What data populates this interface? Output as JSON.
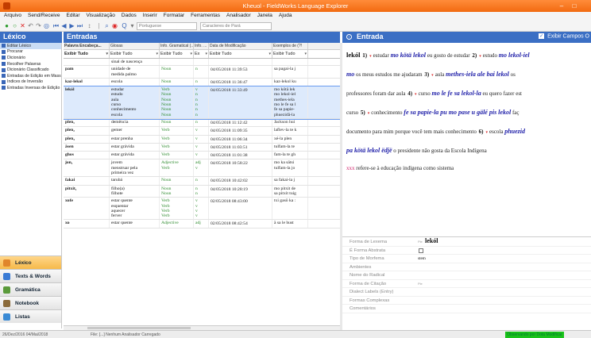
{
  "window": {
    "title": "Kheuol - FieldWorks Language Explorer",
    "minimize_glyph": "‒",
    "maximize_glyph": "□"
  },
  "menu": [
    "Arquivo",
    "Send/Receive",
    "Editar",
    "Visualização",
    "Dados",
    "Inserir",
    "Formatar",
    "Ferramentas",
    "Analisador",
    "Janela",
    "Ajuda"
  ],
  "toolbar": {
    "writing_system": "Portuguese",
    "style": "Caracteres de Pará"
  },
  "left_pane": {
    "title": "Léxico",
    "items": [
      {
        "label": "Editar Léxico",
        "selected": true
      },
      {
        "label": "Procurar",
        "selected": false
      },
      {
        "label": "Dicionário",
        "selected": false
      },
      {
        "label": "Recolher Palavras",
        "selected": false
      },
      {
        "label": "Dicionário Classificado",
        "selected": false
      },
      {
        "label": "Entradas de Edição em Massa",
        "selected": false
      },
      {
        "label": "Índices de Inversão",
        "selected": false
      },
      {
        "label": "Entradas Inversas de Edição",
        "selected": false
      }
    ],
    "nav": [
      {
        "label": "Léxico",
        "color": "#e0862c",
        "selected": true
      },
      {
        "label": "Texts & Words",
        "color": "#3a7bd5",
        "selected": false
      },
      {
        "label": "Gramática",
        "color": "#5a9a3a",
        "selected": false
      },
      {
        "label": "Notebook",
        "color": "#8a6a3a",
        "selected": false
      },
      {
        "label": "Listas",
        "color": "#3a8ad5",
        "selected": false
      }
    ]
  },
  "entries": {
    "title": "Entradas",
    "columns": [
      "Palavra Encabeça...",
      "Glosas",
      "Info. Gramatical (...",
      "Info. ...",
      "Data de Modificação",
      "Exemplos de (?!"
    ],
    "filters": [
      "Exibir Tudo",
      "Exibir Tudo",
      "Exibir Tudo",
      "Ex",
      "Exibir Tudo",
      "Exibir Tudo"
    ],
    "rows": [
      {
        "word": "",
        "gloss": "sinal de nascença",
        "pos": "",
        "info": "",
        "date": "",
        "example": "",
        "selected": false
      },
      {
        "word": "pam",
        "gloss": "unidade de\nmedida palmo",
        "pos": "Noun",
        "info": "n",
        "date": "04/05/2018 11:39:53",
        "example": "sa pagai-la j",
        "selected": false
      },
      {
        "word": "kaz-lekol",
        "gloss": "escola",
        "pos": "Noun",
        "info": "n",
        "date": "04/05/2018 11:36:47",
        "example": "kaz-lekol ku",
        "selected": false
      },
      {
        "word": "lekól",
        "gloss": "estudar\nestudo\naula\ncurso\nconhecimento\nescola",
        "pos": "Verb\nNoun\nNoun\nNoun\nNoun\nNoun",
        "info": "v\nn\nn\nn\nn\nn",
        "date": "04/05/2018 11:33:49",
        "example": "mo kötä lek\nmo lekol-iel\nmethes-iela\nmo le fe sa l\nfe sa papie-\nphuezidã-la",
        "selected": true
      },
      {
        "word": "plen₁",
        "gloss": "demência",
        "pos": "Noun",
        "info": "n",
        "date": "04/05/2018 11:12:42",
        "example": "Jackson hui",
        "selected": false
      },
      {
        "word": "plen₂",
        "gloss": "gemer",
        "pos": "Verb",
        "info": "v",
        "date": "04/05/2018 11:09:35",
        "example": "laflev-la te k",
        "selected": false
      },
      {
        "word": "plen₃",
        "gloss": "estar prenha",
        "pos": "Verb",
        "info": "v",
        "date": "04/05/2018 11:06:34",
        "example": "xé-la plen",
        "selected": false
      },
      {
        "word": "äsen",
        "gloss": "estar grávida",
        "pos": "Verb",
        "info": "v",
        "date": "04/05/2018 11:03:51",
        "example": "tulfam-la te",
        "selected": false
      },
      {
        "word": "ghos",
        "gloss": "estar grávida",
        "pos": "Verb",
        "info": "v",
        "date": "04/05/2018 11:01:38",
        "example": "fam-la te gh",
        "selected": false
      },
      {
        "word": "jon₁",
        "gloss": "jovem\nmenstruar pela\nprimeira vez",
        "pos": "Adjective\nVerb",
        "info": "adj\nv",
        "date": "04/05/2018 10:58:22",
        "example": "mo ka sätsi\ntulfam-la jo",
        "selected": false
      },
      {
        "word": "fakai",
        "gloss": "tarubá",
        "pos": "Noun",
        "info": "n",
        "date": "04/05/2018 10:42:02",
        "example": "sa fakai-la j",
        "selected": false
      },
      {
        "word": "pitxit₁",
        "gloss": "filho(a)\nfilhote",
        "pos": "Noun\nNoun",
        "info": "n\nn",
        "date": "04/05/2018 10:28:19",
        "example": "mo pitxit de\nsa pitxit tuig",
        "selected": false
      },
      {
        "word": "xofe",
        "gloss": "estar quente\nesquentar\naquecer\nferver",
        "pos": "Verb\nVerb\nVerb\nVerb",
        "info": "v\nv\nv\nv",
        "date": "02/05/2018 08:43:00",
        "example": "txi gasö ka :",
        "selected": false
      },
      {
        "word": "xo",
        "gloss": "estar quente",
        "pos": "Adjective",
        "info": "adj",
        "date": "02/05/2018 08:42:54",
        "example": "ä sa le hust",
        "selected": false
      }
    ]
  },
  "entry_pane": {
    "title": "Entrada",
    "show_all_label": "Exibir Campos O",
    "doc": {
      "headword": "lekól",
      "senses": [
        {
          "num": "1)",
          "gloss": "estudar",
          "vern": "mo kötä lekol",
          "tail": "eu gosto de estudar"
        },
        {
          "num": "2)",
          "gloss": "estudo",
          "vern": "mo lekol-iel",
          "tail": ""
        },
        {
          "num": "",
          "gloss": "",
          "vern": "mo",
          "tail": "os meus estudos me ajudaram"
        },
        {
          "num": "3)",
          "gloss": "aula",
          "vern": "methes-iela ale bai lekol",
          "tail": "os"
        },
        {
          "num": "",
          "gloss": "",
          "vern": "",
          "tail": "professores foram dar aula"
        },
        {
          "num": "4)",
          "gloss": "curso",
          "vern": "mo le fe sa lekol-la",
          "tail": "eu quero fazer est"
        },
        {
          "num": "",
          "gloss": "",
          "vern": "",
          "tail": "curso"
        },
        {
          "num": "5)",
          "gloss": "conhecimento",
          "vern": "fe sa papie-la pu mo pase u gälé pis lekol",
          "tail": "faç"
        },
        {
          "num": "",
          "gloss": "",
          "vern": "",
          "tail": "documento para mim porque você tem mais conhecimento"
        },
        {
          "num": "6)",
          "gloss": "escola",
          "vern": "phuezid",
          "tail": ""
        },
        {
          "num": "",
          "gloss": "",
          "vern": "pa kötä lekol ëdjë",
          "tail": "o presidente não gosta da Escola Indígena"
        },
        {
          "num": "",
          "gloss": "",
          "vern": "",
          "tail": "refere-se à educação indígena como sistema",
          "note": "xxx"
        }
      ]
    },
    "properties": [
      {
        "label": "Forma de Lexema",
        "value": "lekól",
        "ws": "Pie",
        "kind": "big"
      },
      {
        "label": "É Forma Abstrata",
        "value": "",
        "ws": "",
        "kind": "checkbox"
      },
      {
        "label": "Tipo de Morfema",
        "value": "stem",
        "ws": "",
        "kind": "small"
      },
      {
        "label": "Ambientes",
        "value": "",
        "ws": "",
        "kind": "small"
      },
      {
        "label": "Nome do Radical",
        "value": "",
        "ws": "",
        "kind": "small"
      },
      {
        "label": "Forma de Citação",
        "value": "",
        "ws": "Pie",
        "kind": "small"
      },
      {
        "label": "Dialect Labels (Entry)",
        "value": "",
        "ws": "",
        "kind": "small"
      },
      {
        "label": "Formas Complexas",
        "value": "",
        "ws": "",
        "kind": "small"
      },
      {
        "label": "Comentários",
        "value": "",
        "ws": "",
        "kind": "small"
      }
    ]
  },
  "status": {
    "left": "26/Dez/2016 04/Mai/2018",
    "middle": "File: [...] Nenhum Analisador Carregado",
    "right": "Observando por Dota Modificar"
  },
  "colors": {
    "titlebar": "#f26a10",
    "pane_header": "#3b6fc4",
    "vernacular": "#1e1ea8",
    "pos_green": "#2e8b2e",
    "status_green": "#19c219"
  }
}
